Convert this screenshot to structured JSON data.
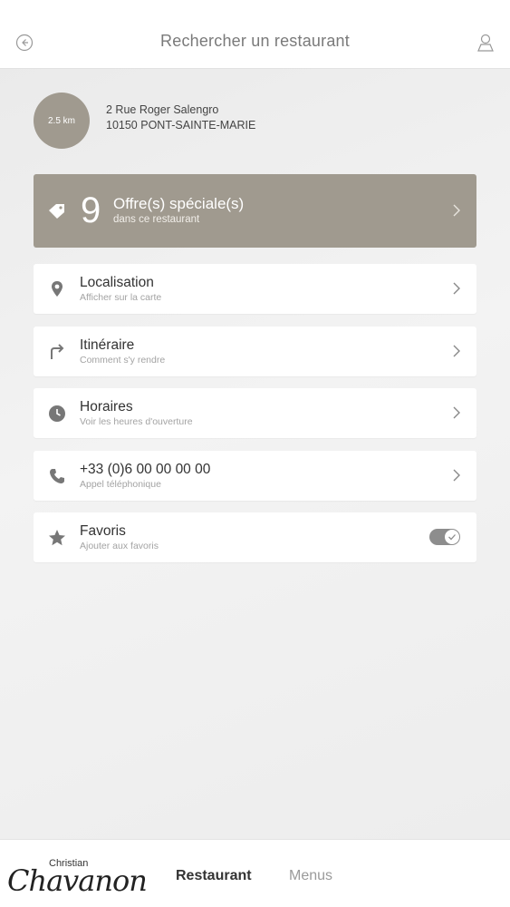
{
  "header": {
    "title": "Rechercher un restaurant",
    "back_icon": "back-arrow-circle-icon",
    "user_icon": "user-location-icon"
  },
  "restaurant": {
    "distance": "2.5 km",
    "address_line1": "2 Rue Roger Salengro",
    "address_line2": "10150 PONT-SAINTE-MARIE"
  },
  "offer": {
    "count": "9",
    "label": "Offre(s) spéciale(s)",
    "sub": "dans ce restaurant",
    "icon": "tag-icon"
  },
  "items": [
    {
      "label": "Localisation",
      "sub": "Afficher sur la carte",
      "icon": "map-pin-icon"
    },
    {
      "label": "Itinéraire",
      "sub": "Comment s'y rendre",
      "icon": "turn-right-arrow-icon"
    },
    {
      "label": "Horaires",
      "sub": "Voir les heures d'ouverture",
      "icon": "clock-icon"
    },
    {
      "label": "+33 (0)6 00 00 00 00",
      "sub": "Appel téléphonique",
      "icon": "phone-icon"
    },
    {
      "label": "Favoris",
      "sub": "Ajouter aux favoris",
      "icon": "star-icon",
      "toggle_on": true
    }
  ],
  "bottom_nav": {
    "logo_small": "Christian",
    "logo_script": "Chavanon",
    "tabs": [
      "Restaurant",
      "Menus"
    ],
    "active_tab": "Restaurant"
  },
  "colors": {
    "accent": "#a09a8f",
    "icon_gray": "#777777"
  }
}
